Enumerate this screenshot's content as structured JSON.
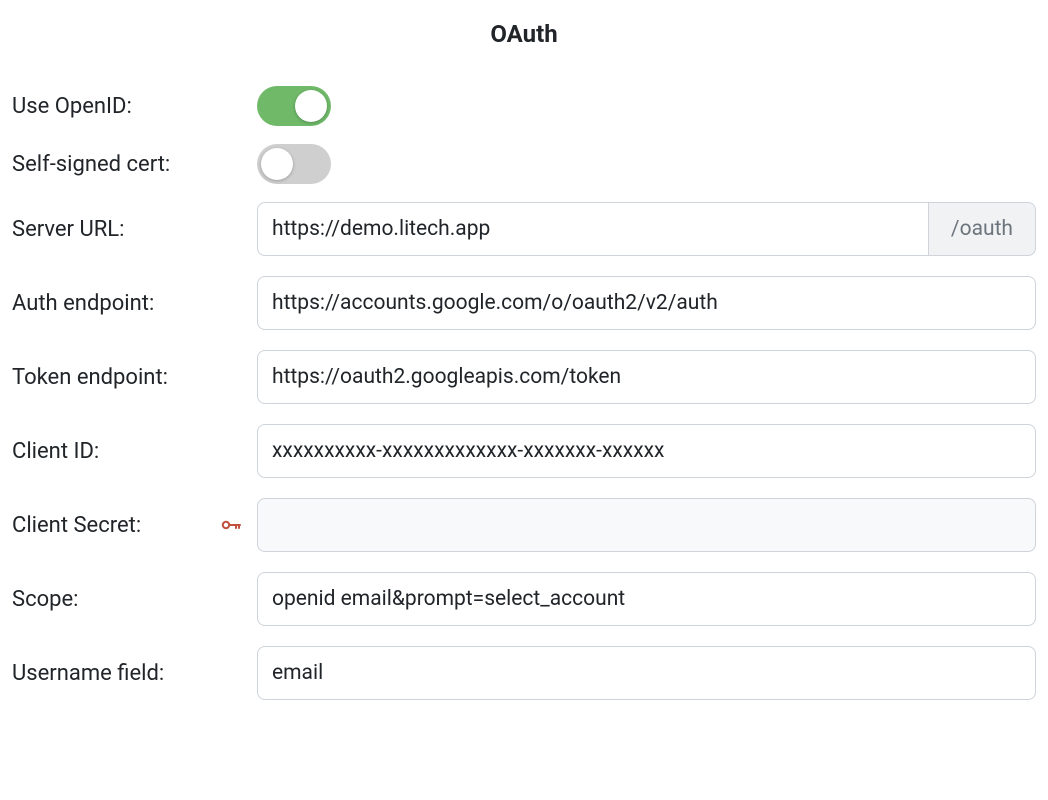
{
  "title": "OAuth",
  "fields": {
    "use_openid": {
      "label": "Use OpenID:",
      "value": true
    },
    "self_signed": {
      "label": "Self-signed cert:",
      "value": false
    },
    "server_url": {
      "label": "Server URL:",
      "value": "https://demo.litech.app",
      "addon": "/oauth"
    },
    "auth_endpoint": {
      "label": "Auth endpoint:",
      "value": "https://accounts.google.com/o/oauth2/v2/auth"
    },
    "token_endpoint": {
      "label": "Token endpoint:",
      "value": "https://oauth2.googleapis.com/token"
    },
    "client_id": {
      "label": "Client ID:",
      "value": "xxxxxxxxxx-xxxxxxxxxxxxx-xxxxxxx-xxxxxx"
    },
    "client_secret": {
      "label": "Client Secret:",
      "value": "",
      "icon": "key-icon"
    },
    "scope": {
      "label": "Scope:",
      "value": "openid email&prompt=select_account"
    },
    "username_field": {
      "label": "Username field:",
      "value": "email"
    }
  }
}
